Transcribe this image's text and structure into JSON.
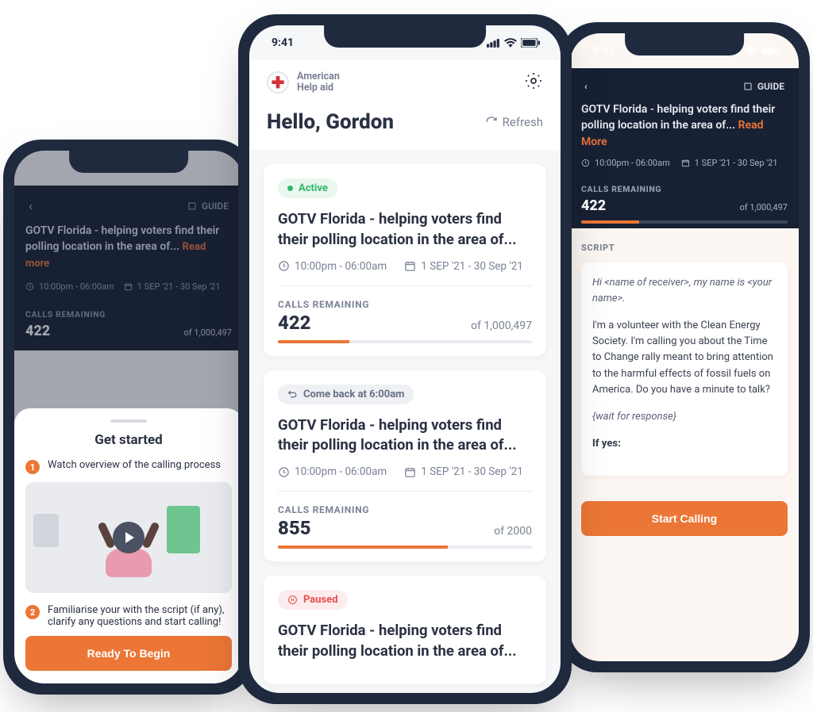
{
  "status_time": "9:41",
  "brand": {
    "line1": "American",
    "line2": "Help aid"
  },
  "center": {
    "greeting": "Hello, Gordon",
    "refresh_label": "Refresh",
    "cards": [
      {
        "badge_text": "Active",
        "title": "GOTV Florida - helping voters find their polling location in  the area of...",
        "time": "10:00pm - 06:00am",
        "dates": "1 SEP '21 - 30 Sep '21",
        "remaining_label": "CALLS REMAINING",
        "remaining": "422",
        "total": "of 1,000,497",
        "pct": 28
      },
      {
        "badge_text": "Come back at 6:00am",
        "title": "GOTV Florida - helping voters find their polling location in  the area of...",
        "time": "10:00pm - 06:00am",
        "dates": "1 SEP '21 - 30 Sep '21",
        "remaining_label": "CALLS REMAINING",
        "remaining": "855",
        "total": "of 2000",
        "pct": 67
      },
      {
        "badge_text": "Paused",
        "title": "GOTV Florida - helping voters find their polling location in  the area of..."
      }
    ]
  },
  "left": {
    "guide_label": "GUIDE",
    "title": "GOTV Florida - helping voters find their polling location in  the area of...",
    "read_more": "Read more",
    "time": "10:00pm - 06:00am",
    "dates": "1 SEP '21 - 30 Sep '21",
    "remaining_label": "CALLS REMAINING",
    "remaining": "422",
    "total": "of 1,000,497",
    "sheet": {
      "heading": "Get started",
      "step1": "Watch overview of the calling process",
      "step2": "Familiarise your with the script (if any), clarify any questions and start calling!",
      "cta": "Ready To Begin"
    }
  },
  "right": {
    "guide_label": "GUIDE",
    "title": "GOTV Florida - helping voters find their polling location in  the area of...",
    "read_more": "Read More",
    "time": "10:00pm - 06:00am",
    "dates": "1 SEP '21 - 30 Sep '21",
    "remaining_label": "CALLS REMAINING",
    "remaining": "422",
    "total": "of 1,000,497",
    "script_label": "SCRIPT",
    "script": {
      "line1": "Hi <name of receiver>, my name is <your name>.",
      "line2": "I'm a volunteer with the Clean Energy Society. I'm calling you about the Time to Change rally meant to bring attention to the harmful effects of fossil fuels on America. Do you have a minute to talk?",
      "line3": "{wait for response}",
      "line4": "If yes:"
    },
    "cta": "Start Calling"
  }
}
